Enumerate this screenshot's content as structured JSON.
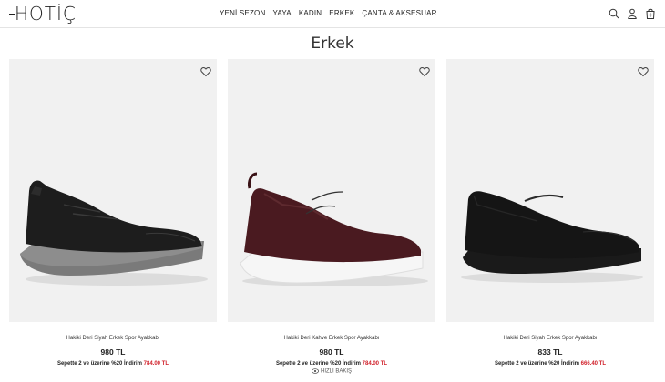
{
  "header": {
    "logo": "HOTİÇ",
    "nav": [
      "YENİ SEZON",
      "YAYA",
      "KADIN",
      "ERKEK",
      "ÇANTA & AKSESUAR"
    ],
    "icons": [
      "search-icon",
      "user-icon",
      "cart-icon"
    ]
  },
  "page_title": "Erkek",
  "products": [
    {
      "name": "Hakiki Deri Siyah Erkek Spor Ayakkabı",
      "price": "980 TL",
      "promo_text": "Sepette 2 ve üzerine %20 İndirim",
      "promo_price": "784.00 TL",
      "color": "#1d1d1d",
      "sole": "#7a7a7a"
    },
    {
      "name": "Hakiki Deri Kahve Erkek Spor Ayakkabı",
      "price": "980 TL",
      "promo_text": "Sepette 2 ve üzerine %20 İndirim",
      "promo_price": "784.00 TL",
      "quick_view": "HIZLI BAKIŞ",
      "color": "#4a1a20",
      "sole": "#f4f4f4"
    },
    {
      "name": "Hakiki Deri Siyah Erkek Spor Ayakkabı",
      "price": "833 TL",
      "promo_text": "Sepette 2 ve üzerine %20 İndirim",
      "promo_price": "666.40 TL",
      "color": "#151515",
      "sole": "#1a1a1a"
    }
  ],
  "colors": {
    "accent": "#d0202a"
  }
}
